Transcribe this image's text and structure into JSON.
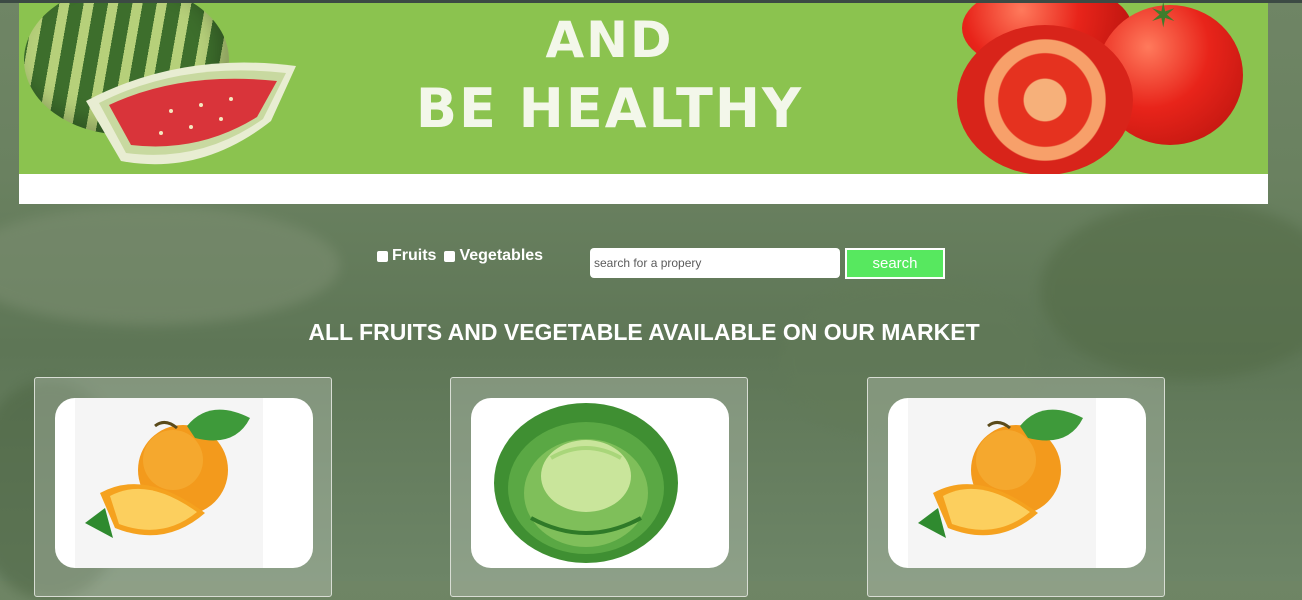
{
  "banner": {
    "line1": "AND",
    "line2": "BE HEALTHY",
    "colors": {
      "green": "#8bc34f",
      "text": "#f3f7ea"
    },
    "images": [
      "watermelon-image",
      "tomato-image"
    ]
  },
  "filters": {
    "options": [
      {
        "label": "Fruits",
        "checked": false
      },
      {
        "label": "Vegetables",
        "checked": false
      }
    ]
  },
  "search": {
    "placeholder": "search for a propery",
    "value": "",
    "button_label": "search",
    "button_color": "#57e85f"
  },
  "section": {
    "title": "ALL FRUITS AND VEGETABLE AVAILABLE ON OUR MARKET"
  },
  "products": [
    {
      "image": "orange-icon"
    },
    {
      "image": "cabbage-icon"
    },
    {
      "image": "orange-icon"
    }
  ]
}
